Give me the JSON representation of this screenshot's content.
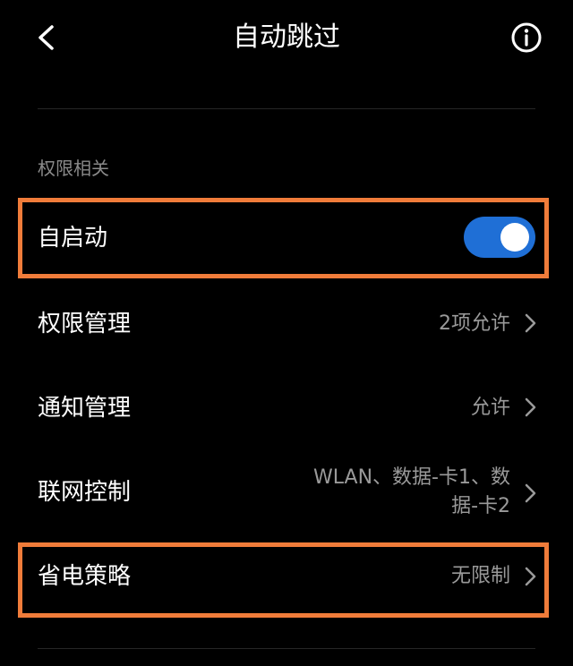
{
  "header": {
    "title": "自动跳过",
    "back_icon": "chevron-left-icon",
    "info_icon": "info-circle-icon"
  },
  "section": {
    "label": "权限相关"
  },
  "rows": [
    {
      "label": "自启动",
      "control": "toggle",
      "enabled": true
    },
    {
      "label": "权限管理",
      "value": "2项允许"
    },
    {
      "label": "通知管理",
      "value": "允许"
    },
    {
      "label": "联网控制",
      "value": "WLAN、数据-卡1、数据-卡2"
    },
    {
      "label": "省电策略",
      "value": "无限制"
    }
  ],
  "colors": {
    "background": "#000000",
    "toggle_on": "#1f6fd6",
    "highlight": "#f07c3a",
    "secondary_text": "#9a9a9a"
  }
}
